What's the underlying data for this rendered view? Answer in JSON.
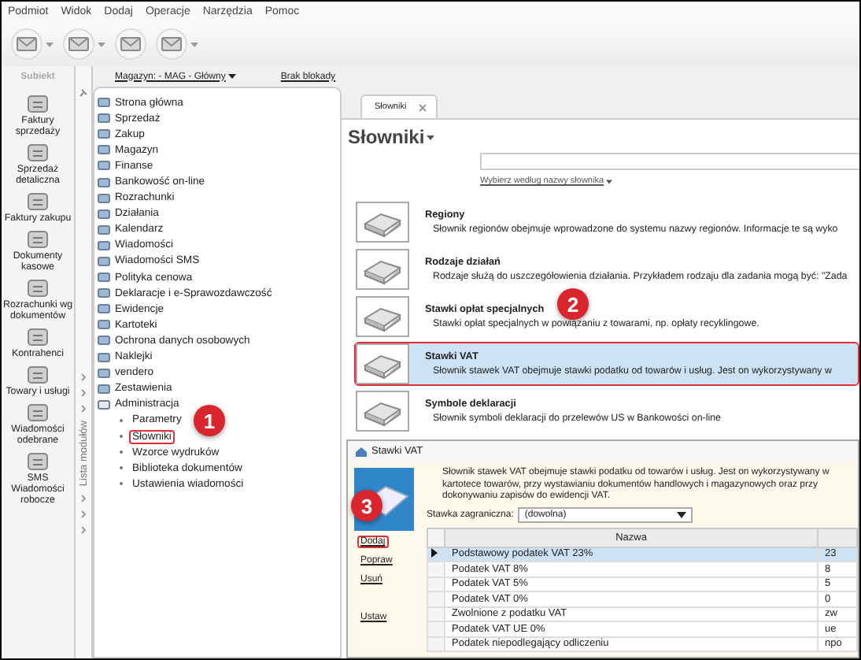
{
  "menu": [
    "Podmiot",
    "Widok",
    "Dodaj",
    "Operacje",
    "Narzędzia",
    "Pomoc"
  ],
  "app_logo": "Subiekt",
  "modules": [
    {
      "label": "Faktury sprzedaży"
    },
    {
      "label": "Sprzedaż detaliczna"
    },
    {
      "label": "Faktury zakupu"
    },
    {
      "label": "Dokumenty kasowe"
    },
    {
      "label": "Rozrachunki wg dokumentów"
    },
    {
      "label": "Kontrahenci"
    },
    {
      "label": "Towary i usługi"
    },
    {
      "label": "Wiadomości odebrane"
    },
    {
      "label": "SMS Wiadomości robocze"
    }
  ],
  "modules_strip": "Lista modułów",
  "header_links": [
    "Magazyn: - MAG - Główny",
    "Brak blokady"
  ],
  "tree": [
    {
      "label": "Strona główna",
      "expanded": false
    },
    {
      "label": "Sprzedaż",
      "expanded": false
    },
    {
      "label": "Zakup",
      "expanded": false
    },
    {
      "label": "Magazyn",
      "expanded": false
    },
    {
      "label": "Finanse",
      "expanded": false
    },
    {
      "label": "Bankowość on-line",
      "expanded": false
    },
    {
      "label": "Rozrachunki",
      "expanded": false
    },
    {
      "label": "Działania",
      "expanded": false
    },
    {
      "label": "Kalendarz",
      "expanded": false
    },
    {
      "label": "Wiadomości",
      "expanded": false
    },
    {
      "label": "Wiadomości SMS",
      "expanded": false
    },
    {
      "label": "Polityka cenowa",
      "expanded": false
    },
    {
      "label": "Deklaracje i e-Sprawozdawczość",
      "expanded": false
    },
    {
      "label": "Ewidencje",
      "expanded": false
    },
    {
      "label": "Kartoteki",
      "expanded": false
    },
    {
      "label": "Ochrona danych osobowych",
      "expanded": false
    },
    {
      "label": "Naklejki",
      "expanded": false
    },
    {
      "label": "vendero",
      "expanded": false
    },
    {
      "label": "Zestawienia",
      "expanded": false
    },
    {
      "label": "Administracja",
      "expanded": true,
      "children": [
        {
          "label": "Parametry",
          "highlighted": false
        },
        {
          "label": "Słowniki",
          "highlighted": true
        },
        {
          "label": "Wzorce wydruków",
          "highlighted": false
        },
        {
          "label": "Biblioteka dokumentów",
          "highlighted": false
        },
        {
          "label": "Ustawienia wiadomości",
          "highlighted": false
        }
      ]
    }
  ],
  "tab": {
    "label": "Słowniki"
  },
  "heading": "Słowniki",
  "filter_link": "Wybierz według nazwy słownika",
  "dictionaries": [
    {
      "title": "Regiony",
      "description": "Słownik regionów obejmuje wprowadzone do systemu nazwy regionów. Informacje te są wyko",
      "selected": false,
      "highlighted": false
    },
    {
      "title": "Rodzaje działań",
      "description": "Rodzaje służą do uszczegółowienia działania. Przykładem rodzaju dla zadania mogą być: \"Zada",
      "selected": false,
      "highlighted": false
    },
    {
      "title": "Stawki opłat specjalnych",
      "description": "Stawki opłat specjalnych w powiązaniu z towarami, np. opłaty recyklingowe.",
      "selected": false,
      "highlighted": false
    },
    {
      "title": "Stawki VAT",
      "description": "Słownik stawek VAT obejmuje stawki podatku od towarów i usług. Jest on wykorzystywany w",
      "selected": true,
      "highlighted": true
    },
    {
      "title": "Symbole deklaracji",
      "description": "Słownik symboli deklaracji do przelewów US w Bankowości on-line",
      "selected": false,
      "highlighted": false
    }
  ],
  "dialog": {
    "title": "Stawki VAT",
    "description": "Słownik stawek VAT obejmuje stawki podatku od towarów i usług. Jest on wykorzystywany w kartotece towarów, przy wystawianiu dokumentów handlowych i magazynowych oraz przy dokonywaniu zapisów do ewidencji VAT.",
    "actions": [
      {
        "label": "Dodaj",
        "highlighted": true
      },
      {
        "label": "Popraw",
        "highlighted": false
      },
      {
        "label": "Usuń",
        "highlighted": false
      },
      {
        "label": "Ustaw",
        "highlighted": false
      }
    ],
    "foreign_rate": {
      "label": "Stawka zagraniczna:",
      "value": "(dowolna)"
    },
    "table": {
      "columns": [
        "Nazwa"
      ],
      "rows": [
        {
          "name": "Podstawowy podatek VAT 23%",
          "code": "23",
          "selected": true
        },
        {
          "name": "Podatek VAT 8%",
          "code": "8",
          "selected": false
        },
        {
          "name": "Podatek VAT 5%",
          "code": "5",
          "selected": false
        },
        {
          "name": "Podatek VAT 0%",
          "code": "0",
          "selected": false
        },
        {
          "name": "Zwolnione z podatku VAT",
          "code": "zw",
          "selected": false
        },
        {
          "name": "Podatek VAT UE 0%",
          "code": "ue",
          "selected": false
        },
        {
          "name": "Podatek niepodlegający odliczeniu",
          "code": "npo",
          "selected": false
        }
      ]
    }
  },
  "callouts": [
    "1",
    "2",
    "3"
  ]
}
